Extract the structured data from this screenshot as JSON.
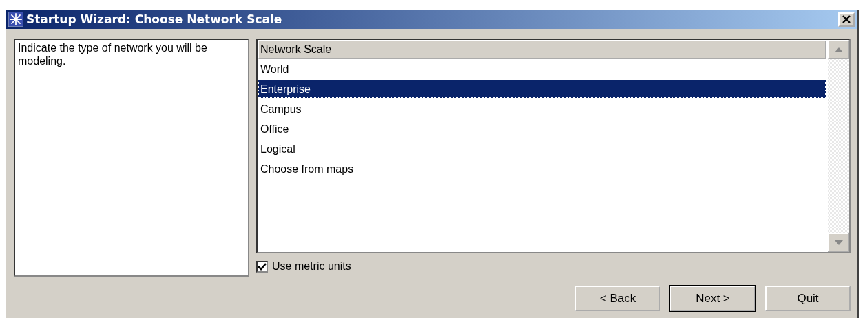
{
  "window": {
    "title": "Startup Wizard: Choose Network Scale"
  },
  "description": "Indicate the type of network you will be modeling.",
  "list": {
    "header": "Network Scale",
    "items": [
      {
        "label": "World",
        "selected": false
      },
      {
        "label": "Enterprise",
        "selected": true
      },
      {
        "label": "Campus",
        "selected": false
      },
      {
        "label": "Office",
        "selected": false
      },
      {
        "label": "Logical",
        "selected": false
      },
      {
        "label": "Choose from maps",
        "selected": false
      }
    ]
  },
  "metric": {
    "label": "Use metric units",
    "checked": true
  },
  "buttons": [
    {
      "label": "< Back",
      "default": false
    },
    {
      "label": "Next >",
      "default": true
    },
    {
      "label": "Quit",
      "default": false
    }
  ]
}
